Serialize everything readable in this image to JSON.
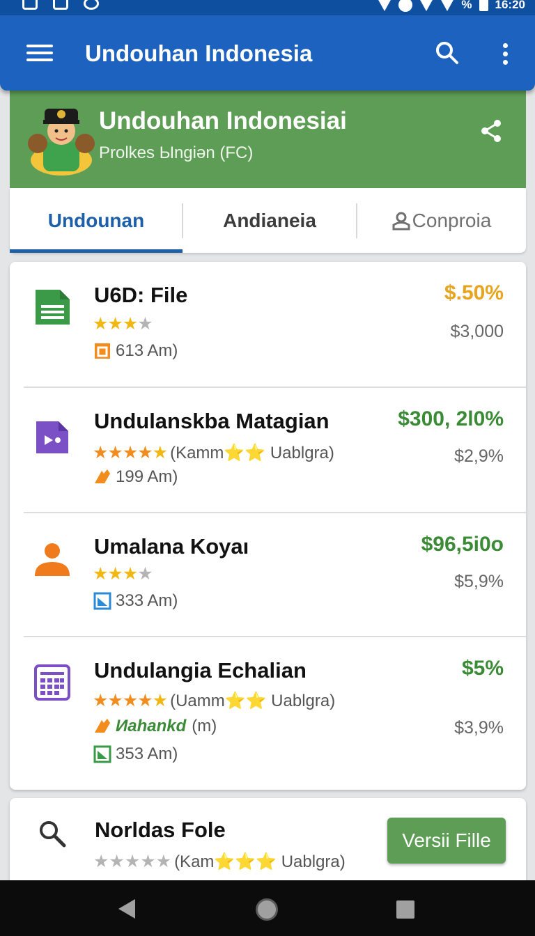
{
  "status_bar": {
    "battery_percent": "%",
    "time": "16:20"
  },
  "app_bar": {
    "title": "Undouhan Indonesia",
    "icons": [
      "menu-icon",
      "search-icon",
      "more-vert-icon"
    ]
  },
  "profile": {
    "title": "Undouhan Indonesiai",
    "subtitle": "Prolkes Ыngiən (FC)",
    "icons": [
      "avatar",
      "share-icon"
    ]
  },
  "tabs": [
    {
      "label": "Undounan",
      "selected": true
    },
    {
      "label": "Andianeia",
      "selected": false
    },
    {
      "label": "Conproia",
      "selected": false,
      "icon": "person-icon"
    }
  ],
  "items": [
    {
      "title": "U6D: File",
      "icon": "document-icon",
      "rating": "3/4",
      "meta": "613 Am)",
      "price": "$.50%",
      "sub": "$3,000",
      "color": "#e8a41c"
    },
    {
      "title": "Undulanskba Matagian",
      "icon": "video-icon",
      "rating": "5/5",
      "rating_note": "(Kamm⭐⭐ Uablgra)",
      "meta": "199 Am)",
      "price": "$300, 2l0%",
      "sub": "$2,9%",
      "color": "#3b8a36"
    },
    {
      "title": "Umalana Koyaı",
      "icon": "person-icon",
      "rating": "3/4",
      "meta": "333 Am)",
      "price": "$96,5i0o",
      "sub": "$5,9%",
      "color": "#3b8a36"
    },
    {
      "title": "Undulangia Echalian",
      "icon": "grid-icon",
      "rating": "5/5",
      "rating_note": "(Uamm⭐⭐ Uablgra)",
      "extra": "Иahankd",
      "extra_note": "(m)",
      "meta": "353 Am)",
      "price": "$5%",
      "sub": "$3,9%",
      "color": "#3b8a36"
    }
  ],
  "card2": {
    "title": "Norldas Fole",
    "icon": "search-icon",
    "rating_note": "(Kam⭐⭐⭐ Uablgra)",
    "button_label": "Versii Fille"
  },
  "colors": {
    "app_bar": "#1c62be",
    "profile_bg": "#5e9d55",
    "tab_active": "#1d5fa8",
    "price_green": "#3b8a36",
    "price_amber": "#e8a41c"
  }
}
